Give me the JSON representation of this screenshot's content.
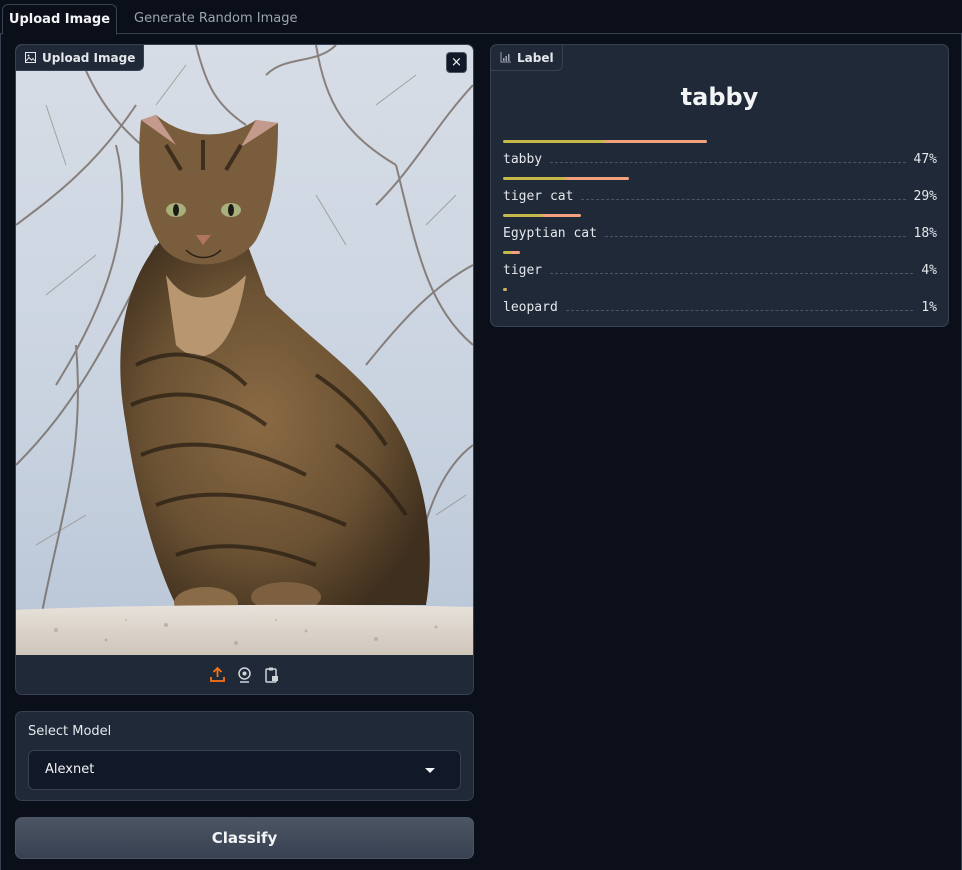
{
  "tabs": [
    {
      "label": "Upload Image",
      "active": true
    },
    {
      "label": "Generate Random Image",
      "active": false
    }
  ],
  "image_panel": {
    "badge_label": "Upload Image",
    "close_label": "×",
    "toolbar_icons": [
      "upload-icon",
      "webcam-icon",
      "clipboard-icon"
    ]
  },
  "model_select": {
    "label": "Select Model",
    "value": "Alexnet"
  },
  "classify_button": "Classify",
  "label_panel": {
    "badge_label": "Label",
    "top_label": "tabby",
    "confidences": [
      {
        "label": "tabby",
        "percent_text": "47%",
        "value": 0.47
      },
      {
        "label": "tiger cat",
        "percent_text": "29%",
        "value": 0.29
      },
      {
        "label": "Egyptian cat",
        "percent_text": "18%",
        "value": 0.18
      },
      {
        "label": "tiger",
        "percent_text": "4%",
        "value": 0.04
      },
      {
        "label": "leopard",
        "percent_text": "1%",
        "value": 0.01
      }
    ]
  },
  "colors": {
    "background": "#0b0f19",
    "panel": "#1f2937",
    "border": "#374151",
    "bar_start": "#c6b74a",
    "bar_end": "#f3a17f",
    "upload_icon": "#f97316"
  }
}
